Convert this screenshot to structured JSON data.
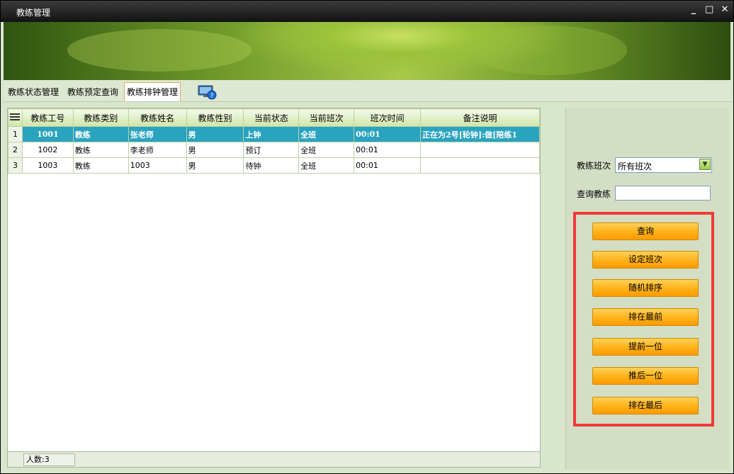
{
  "window": {
    "title": "教练管理",
    "controls": [
      "_",
      "□",
      "✕"
    ]
  },
  "tabs": [
    {
      "label": "教练状态管理",
      "active": false
    },
    {
      "label": "教练预定查询",
      "active": false
    },
    {
      "label": "教练排钟管理",
      "active": true
    }
  ],
  "grid": {
    "columns": [
      "教练工号",
      "教练类别",
      "教练姓名",
      "教练性别",
      "当前状态",
      "当前班次",
      "班次时间",
      "备注说明"
    ],
    "rows": [
      {
        "rn": "1",
        "id": "1001",
        "type": "教练",
        "name": "张老师",
        "sex": "男",
        "state": "上钟",
        "shift": "全班",
        "time": "00:01",
        "note": "正在为2号[轮钟]:做[陪练1",
        "selected": true
      },
      {
        "rn": "2",
        "id": "1002",
        "type": "教练",
        "name": "李老师",
        "sex": "男",
        "state": "预订",
        "shift": "全班",
        "time": "00:01",
        "note": "",
        "selected": false
      },
      {
        "rn": "3",
        "id": "1003",
        "type": "教练",
        "name": "1003",
        "sex": "男",
        "state": "待钟",
        "shift": "全班",
        "time": "00:01",
        "note": "",
        "selected": false
      }
    ]
  },
  "status": {
    "count": "人数:3"
  },
  "panel": {
    "shift_label": "教练班次",
    "shift_value": "所有班次",
    "search_label": "查询教练",
    "search_value": "",
    "buttons": [
      "查询",
      "设定班次",
      "随机排序",
      "排在最前",
      "提前一位",
      "推后一位",
      "排在最后"
    ]
  },
  "colors": {
    "selected_row": "#2aa3bf",
    "button": "#ffb41c",
    "highlight_box": "#f03a3a"
  }
}
